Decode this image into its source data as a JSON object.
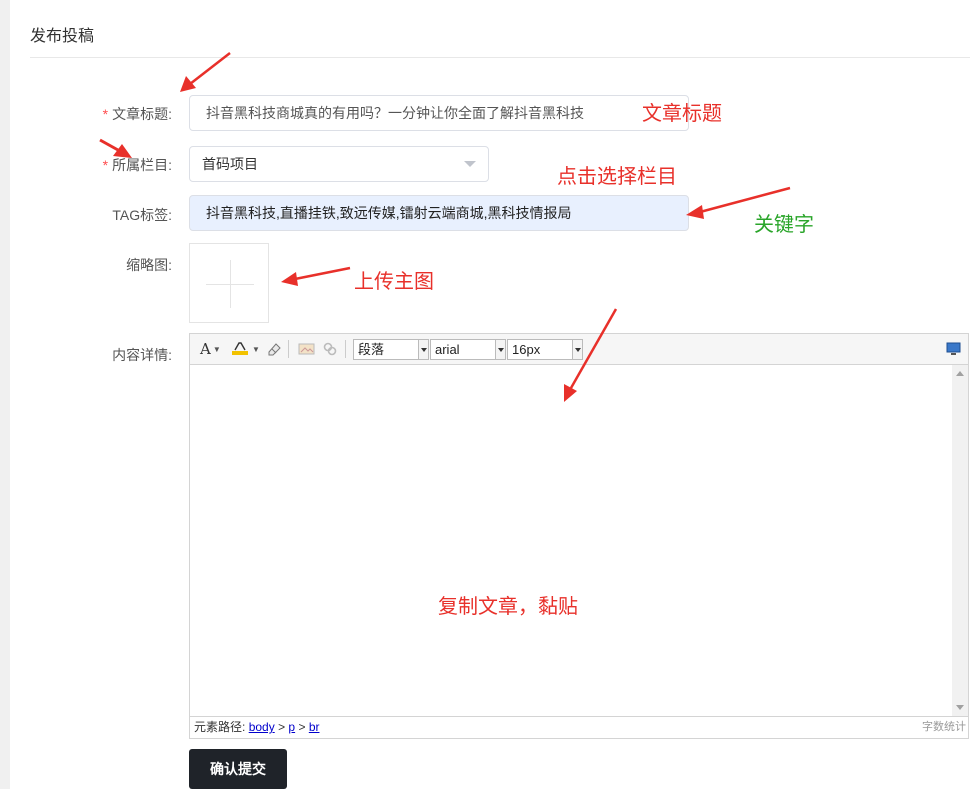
{
  "page": {
    "title": "发布投稿"
  },
  "form": {
    "title_field": {
      "label": "文章标题:",
      "value": "抖音黑科技商城真的有用吗？一分钟让你全面了解抖音黑科技"
    },
    "category_field": {
      "label": "所属栏目:",
      "value": "首码项目"
    },
    "tag_field": {
      "label": "TAG标签:",
      "value": "抖音黑科技,直播挂铁,致远传媒,镭射云端商城,黑科技情报局"
    },
    "thumbnail_field": {
      "label": "缩略图:"
    },
    "content_field": {
      "label": "内容详情:"
    },
    "required_mark": "*"
  },
  "editor": {
    "toolbar": {
      "font_color_glyph": "A",
      "paragraph_format": "段落",
      "font_family": "arial",
      "font_size": "16px"
    },
    "status": {
      "path_label": "元素路径:",
      "path_items": [
        "body",
        "p",
        "br"
      ],
      "separator": ">",
      "word_count": "字数统计"
    }
  },
  "submit": {
    "label": "确认提交"
  },
  "annotations": {
    "article_title": "文章标题",
    "choose_category": "点击选择栏目",
    "keywords": "关键字",
    "upload_main_image": "上传主图",
    "paste_article": "复制文章，黏贴"
  },
  "colors": {
    "annotation_red": "#e8302a",
    "annotation_green": "#2aa52a",
    "submit_bg": "#1f2329"
  }
}
